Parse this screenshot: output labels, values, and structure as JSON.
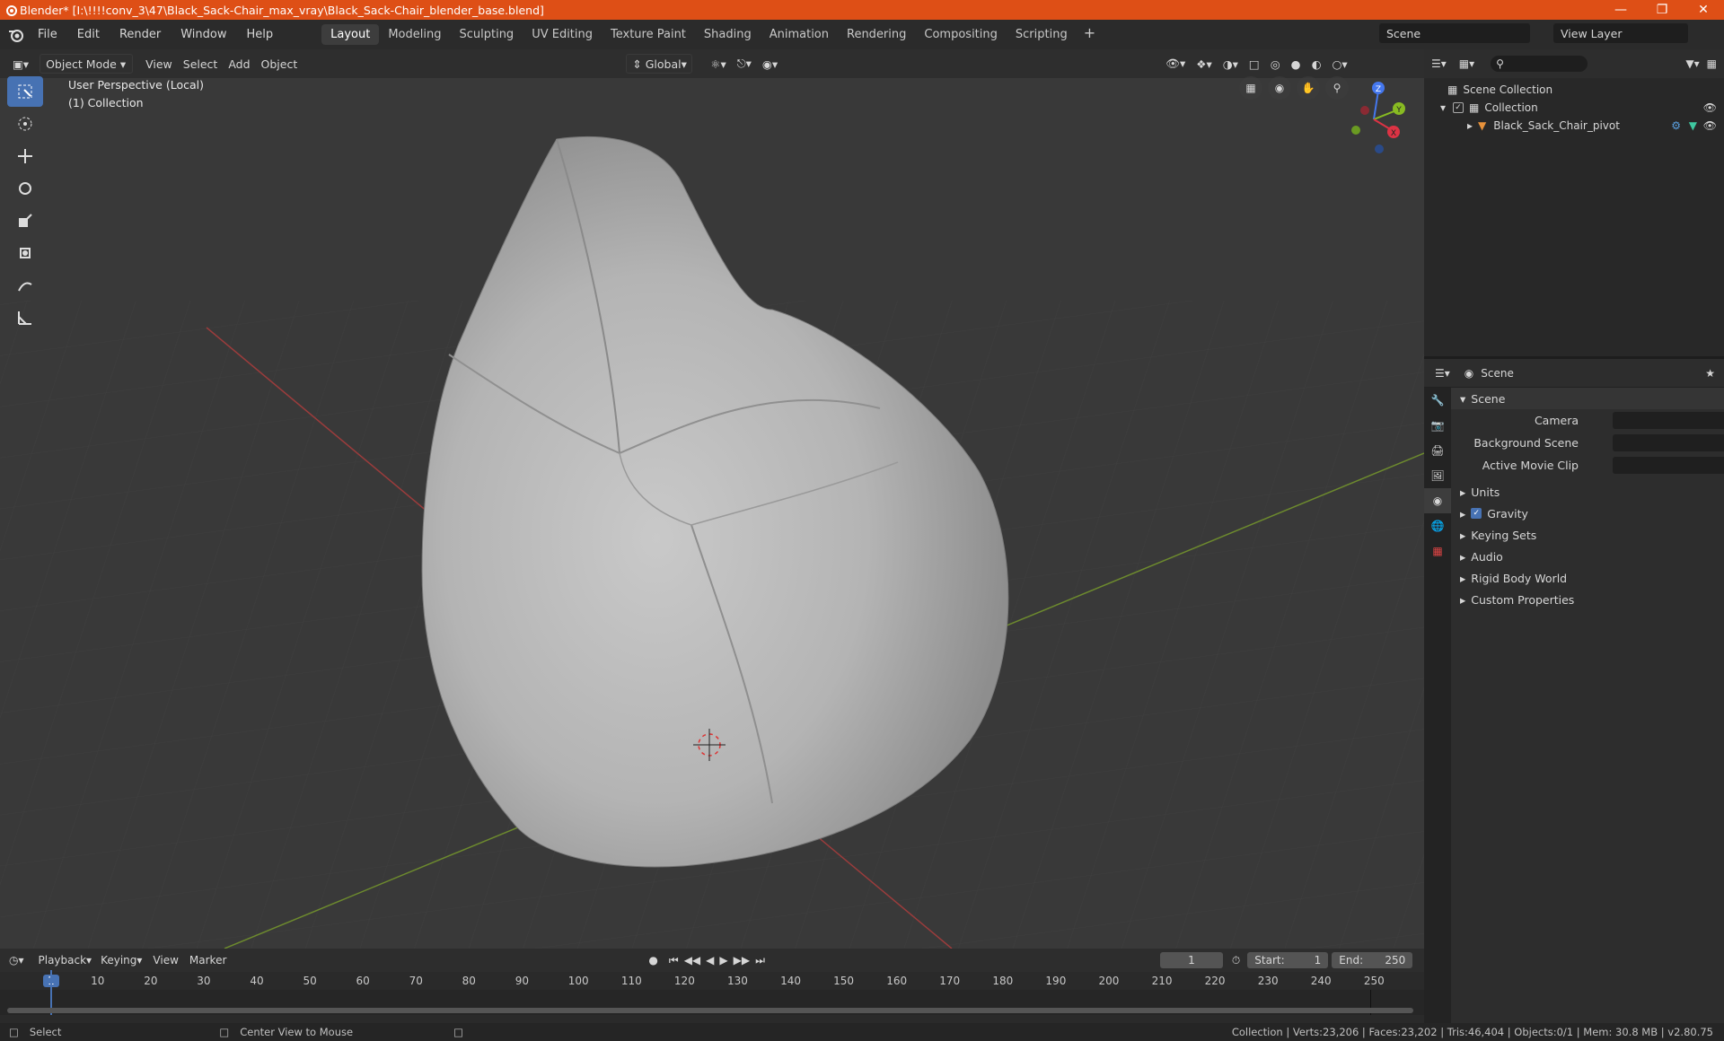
{
  "title": "Blender* [I:\\!!!!conv_3\\47\\Black_Sack-Chair_max_vray\\Black_Sack-Chair_blender_base.blend]",
  "menu": [
    "File",
    "Edit",
    "Render",
    "Window",
    "Help"
  ],
  "workspaces": [
    "Layout",
    "Modeling",
    "Sculpting",
    "UV Editing",
    "Texture Paint",
    "Shading",
    "Animation",
    "Rendering",
    "Compositing",
    "Scripting"
  ],
  "scene_name": "Scene",
  "view_layer": "View Layer",
  "viewport": {
    "mode": "Object Mode",
    "menus": [
      "View",
      "Select",
      "Add",
      "Object"
    ],
    "transform": "Global",
    "info_line1": "User Perspective (Local)",
    "info_line2": "(1) Collection"
  },
  "gizmo_axes": {
    "x": "X",
    "y": "Y",
    "z": "Z"
  },
  "outliner": {
    "root": "Scene Collection",
    "collection": "Collection",
    "object": "Black_Sack_Chair_pivot"
  },
  "properties": {
    "context": "Scene",
    "section": "Scene",
    "camera_label": "Camera",
    "bg_scene_label": "Background Scene",
    "movie_clip_label": "Active Movie Clip",
    "panels": [
      "Units",
      "Gravity",
      "Keying Sets",
      "Audio",
      "Rigid Body World",
      "Custom Properties"
    ]
  },
  "timeline": {
    "menus": [
      "Playback",
      "Keying",
      "View",
      "Marker"
    ],
    "current_frame": "1",
    "start_label": "Start:",
    "start": "1",
    "end_label": "End:",
    "end": "250",
    "ticks": [
      "1",
      "10",
      "20",
      "30",
      "40",
      "50",
      "60",
      "70",
      "80",
      "90",
      "100",
      "110",
      "120",
      "130",
      "140",
      "150",
      "160",
      "170",
      "180",
      "190",
      "200",
      "210",
      "220",
      "230",
      "240",
      "250"
    ]
  },
  "status": {
    "left": "Select",
    "mid": "Center View to Mouse",
    "right": "Collection | Verts:23,206 | Faces:23,202 | Tris:46,404 | Objects:0/1 | Mem: 30.8 MB | v2.80.75"
  }
}
